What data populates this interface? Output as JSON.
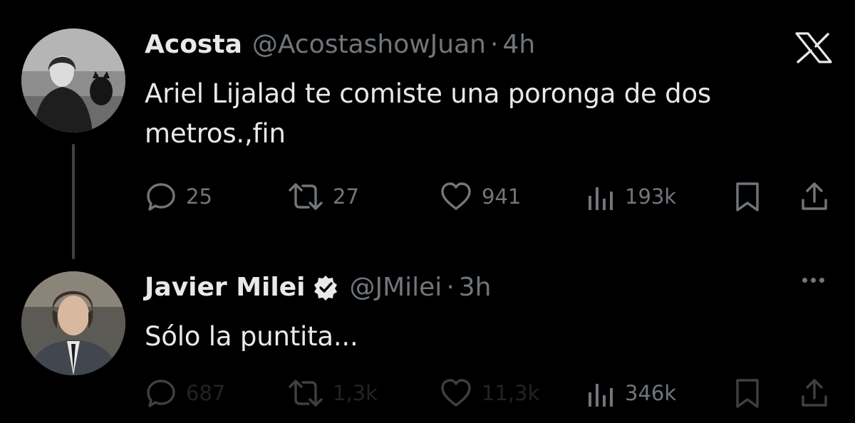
{
  "app": {
    "logo": "x-logo"
  },
  "tweets": [
    {
      "name": "Acosta",
      "handle": "@AcostashowJuan",
      "separator": "·",
      "time": "4h",
      "verified": false,
      "text_lines": [
        "Ariel Lijalad te comiste una poronga de dos",
        "metros.,fin"
      ],
      "stats": {
        "replies": "25",
        "retweets": "27",
        "likes": "941",
        "views": "193k"
      }
    },
    {
      "name": "Javier Milei",
      "handle": "@JMilei",
      "separator": "·",
      "time": "3h",
      "verified": true,
      "text_lines": [
        "Sólo la puntita..."
      ],
      "stats": {
        "replies": "687",
        "retweets": "1,3k",
        "likes": "11,3k",
        "views": "346k"
      }
    }
  ],
  "colors": {
    "background": "#000000",
    "text": "#e7e9ea",
    "secondary": "#71767b",
    "thread_line": "#3d4248",
    "verified_blue": "#1d9bf0"
  },
  "icons": [
    "reply-icon",
    "retweet-icon",
    "like-icon",
    "views-icon",
    "bookmark-icon",
    "share-icon",
    "more-icon",
    "verified-badge-icon"
  ]
}
